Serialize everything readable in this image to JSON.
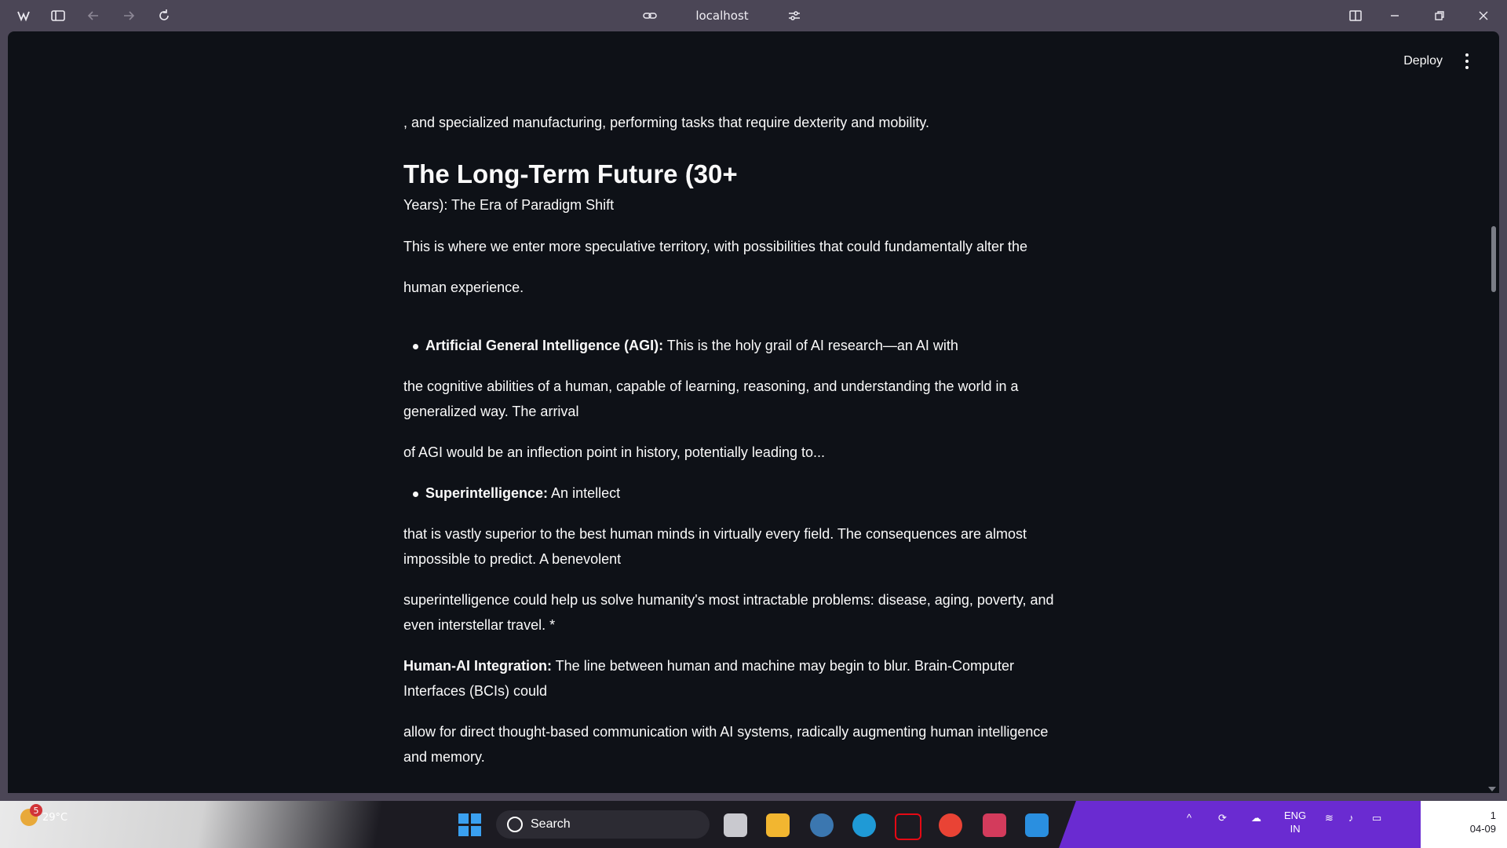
{
  "browser": {
    "address": "localhost",
    "icons": [
      "app-logo-icon",
      "sidebar-toggle-icon",
      "back-icon",
      "forward-icon",
      "reload-icon",
      "link-icon",
      "site-settings-icon",
      "split-view-icon",
      "minimize-icon",
      "restore-icon",
      "close-icon"
    ]
  },
  "header": {
    "deploy_label": "Deploy",
    "menu_icon": "kebab-menu-icon"
  },
  "article": {
    "lead_fragment": ", and specialized manufacturing, performing tasks that require dexterity and mobility.",
    "heading": "The Long-Term Future (30+",
    "heading_cont": "Years): The Era of Paradigm Shift",
    "intro_1": "This is where we enter more speculative territory, with possibilities that could fundamentally alter the",
    "intro_2": "human experience.",
    "agi_label": "Artificial General Intelligence (AGI):",
    "agi_text": " This is the holy grail of AI research—an AI with",
    "agi_cont_1": "the cognitive abilities of a human, capable of learning, reasoning, and understanding the world in a",
    "agi_cont_2": "generalized way. The arrival",
    "agi_cont_3": "of AGI would be an inflection point in history, potentially leading to...",
    "si_label": "Superintelligence:",
    "si_text": " An intellect",
    "si_cont_1": "that is vastly superior to the best human minds in virtually every field. The consequences are almost",
    "si_cont_2": "impossible to predict. A benevolent",
    "si_cont_3": "superintelligence could help us solve humanity's most intractable problems: disease, aging, poverty, and",
    "si_cont_4": "even interstellar travel. *",
    "hai_label": "Human-AI Integration:",
    "hai_text": " The line between human and machine may begin to blur. Brain-Computer",
    "hai_cont_1": "Interfaces (BCIs) could",
    "hai_cont_2": "allow for direct thought-based communication with AI systems, radically augmenting human intelligence",
    "hai_cont_3": "and memory."
  },
  "taskbar": {
    "weather_temp": "29°C",
    "weather_badge": "5",
    "search_label": "Search",
    "lang_1": "ENG",
    "lang_2": "IN",
    "time": "1",
    "date": "04-09",
    "apps": [
      "windows-start-icon",
      "task-view-icon",
      "file-explorer-icon",
      "python-icon",
      "edge-icon",
      "netflix-icon",
      "chrome-icon",
      "arc-browser-icon",
      "vscode-icon"
    ],
    "accent": "#3aa0f0"
  }
}
